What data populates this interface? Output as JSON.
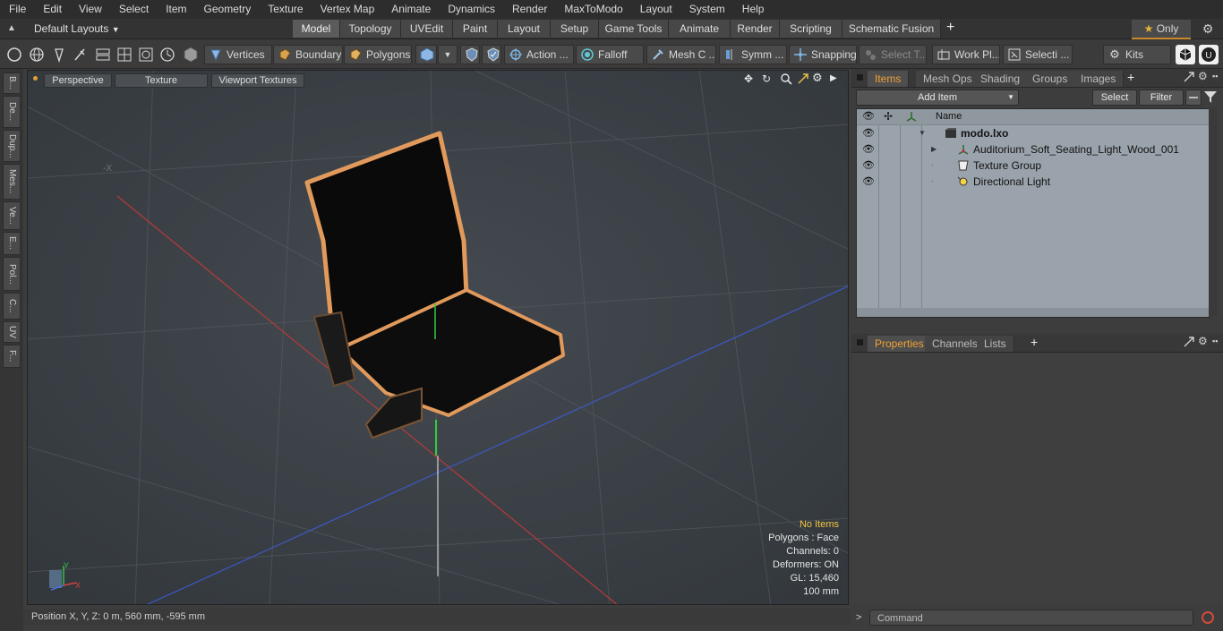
{
  "menu": [
    "File",
    "Edit",
    "View",
    "Select",
    "Item",
    "Geometry",
    "Texture",
    "Vertex Map",
    "Animate",
    "Dynamics",
    "Render",
    "MaxToModo",
    "Layout",
    "System",
    "Help"
  ],
  "layout_selector": "Default Layouts",
  "mode_tabs": [
    "Model",
    "Topology",
    "UVEdit",
    "Paint",
    "Layout",
    "Setup",
    "Game Tools",
    "Animate",
    "Render",
    "Scripting",
    "Schematic Fusion"
  ],
  "active_mode_tab": "Model",
  "only_label": "Only",
  "toolbar": {
    "vertices": "Vertices",
    "boundary": "Boundary",
    "polygons": "Polygons",
    "action": "Action ...",
    "falloff": "Falloff",
    "mesh_c": "Mesh C ...",
    "symm": "Symm ...",
    "snapping": "Snapping",
    "select_t": "Select T...",
    "work_pl": "Work Pl...",
    "selecti": "Selecti ...",
    "kits": "Kits"
  },
  "left_tabs": [
    "B...",
    "De...",
    "Dup...",
    "Mes...",
    "Ve...",
    "E...",
    "Pol...",
    "C...",
    "UV",
    "F..."
  ],
  "viewport": {
    "view_mode": "Perspective",
    "shading": "Texture",
    "viewport_textures": "Viewport Textures",
    "axis_label_minus_x": "-X",
    "info": {
      "items": "No Items",
      "polygons": "Polygons : Face",
      "channels": "Channels: 0",
      "deformers": "Deformers: ON",
      "gl": "GL: 15,460",
      "unit": "100 mm"
    },
    "axis_gizmo": {
      "y": "Y",
      "x": "X"
    }
  },
  "status": {
    "position": "Position X, Y, Z:   0 m, 560 mm, -595 mm"
  },
  "items_panel": {
    "tabs": [
      "Items",
      "Mesh Ops",
      "Shading",
      "Groups",
      "Images"
    ],
    "active_tab": "Items",
    "add_item": "Add Item",
    "select": "Select",
    "filter": "Filter",
    "column_name": "Name",
    "tree": [
      {
        "label": "modo.lxo",
        "level": 0,
        "icon": "scene-icon",
        "bold": true
      },
      {
        "label": "Auditorium_Soft_Seating_Light_Wood_001",
        "level": 1,
        "icon": "mesh-icon"
      },
      {
        "label": "Texture Group",
        "level": 1,
        "icon": "texture-group-icon"
      },
      {
        "label": "Directional Light",
        "level": 1,
        "icon": "light-icon"
      }
    ]
  },
  "properties_panel": {
    "tabs": [
      "Properties",
      "Channels",
      "Lists"
    ],
    "active_tab": "Properties"
  },
  "command": {
    "placeholder": "Command"
  },
  "colors": {
    "accent": "#f0a235",
    "info_highlight": "#f2c641",
    "selection_outline": "#e19a5c"
  }
}
